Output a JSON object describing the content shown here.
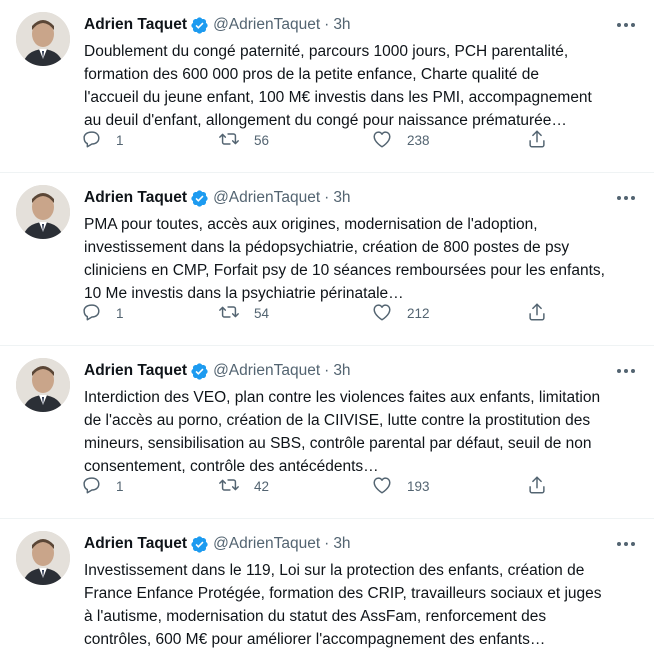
{
  "tweets": [
    {
      "author": "Adrien Taquet",
      "handle": "@AdrienTaquet",
      "separator": "·",
      "time": "3h",
      "text": "Doublement du congé paternité, parcours 1000 jours, PCH parentalité,\nformation des 600 000 pros de la petite enfance, Charte qualité de\nl'accueil du jeune enfant, 100 M€ investis dans les PMI, accompagnement\nau deuil d'enfant, allongement du congé pour naissance prématurée…",
      "replies": "1",
      "retweets": "56",
      "likes": "238"
    },
    {
      "author": "Adrien Taquet",
      "handle": "@AdrienTaquet",
      "separator": "·",
      "time": "3h",
      "text": "PMA pour toutes, accès aux origines, modernisation de l'adoption,\ninvestissement dans la pédopsychiatrie, création de 800 postes de psy\ncliniciens en CMP, Forfait psy de 10 séances remboursées pour les enfants,\n10 Me investis dans la psychiatrie périnatale…",
      "replies": "1",
      "retweets": "54",
      "likes": "212"
    },
    {
      "author": "Adrien Taquet",
      "handle": "@AdrienTaquet",
      "separator": "·",
      "time": "3h",
      "text": "Interdiction des VEO, plan contre les violences faites aux enfants, limitation\nde l'accès au porno, création de la CIIVISE, lutte contre la prostitution des\nmineurs, sensibilisation au SBS, contrôle parental par défaut, seuil de non\nconsentement, contrôle des antécédents…",
      "replies": "1",
      "retweets": "42",
      "likes": "193"
    },
    {
      "author": "Adrien Taquet",
      "handle": "@AdrienTaquet",
      "separator": "·",
      "time": "3h",
      "text": "Investissement dans le 119, Loi sur la protection des enfants, création de\nFrance Enfance Protégée, formation des CRIP, travailleurs sociaux et juges\nà l'autisme, modernisation du statut des AssFam, renforcement des\ncontrôles, 600 M€ pour améliorer l'accompagnement des enfants…"
    }
  ],
  "icons": {
    "verified": "verified-badge-icon",
    "more": "more-dots-icon",
    "reply": "reply-icon",
    "retweet": "retweet-icon",
    "like": "heart-icon",
    "share": "share-icon"
  },
  "colors": {
    "verified": "#1d9bf0",
    "text": "#0f1419",
    "secondary": "#536471"
  }
}
